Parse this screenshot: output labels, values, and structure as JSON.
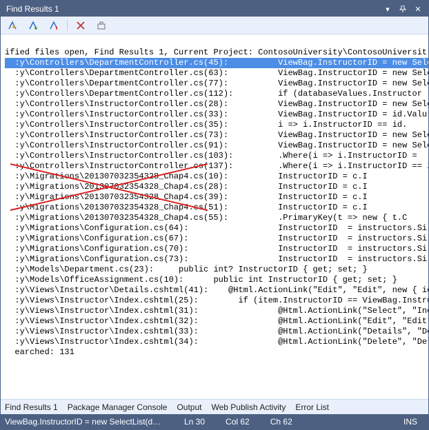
{
  "window": {
    "title": "Find Results 1"
  },
  "header_line": "ified files open, Find Results 1, Current Project: ContosoUniversity\\ContosoUniversit",
  "lines": [
    {
      "path": ":y\\Controllers\\DepartmentController.cs(45):",
      "code": "ViewBag.InstructorID = new Select",
      "selected": true,
      "struck": false
    },
    {
      "path": ":y\\Controllers\\DepartmentController.cs(63):",
      "code": "ViewBag.InstructorID = new Select",
      "selected": false,
      "struck": false
    },
    {
      "path": ":y\\Controllers\\DepartmentController.cs(77):",
      "code": "ViewBag.InstructorID = new Select",
      "selected": false,
      "struck": false
    },
    {
      "path": ":y\\Controllers\\DepartmentController.cs(112):",
      "code": "if (databaseValues.Instructor",
      "selected": false,
      "struck": false
    },
    {
      "path": ":y\\Controllers\\InstructorController.cs(28):",
      "code": "ViewBag.InstructorID = new Selec",
      "selected": false,
      "struck": false
    },
    {
      "path": ":y\\Controllers\\InstructorController.cs(33):",
      "code": "ViewBag.InstructorID = id.Valu",
      "selected": false,
      "struck": false
    },
    {
      "path": ":y\\Controllers\\InstructorController.cs(35):",
      "code": "i => i.InstructorID == id.",
      "selected": false,
      "struck": false
    },
    {
      "path": ":y\\Controllers\\InstructorController.cs(73):",
      "code": "ViewBag.InstructorID = new Select",
      "selected": false,
      "struck": false
    },
    {
      "path": ":y\\Controllers\\InstructorController.cs(91):",
      "code": "ViewBag.InstructorID = new Select",
      "selected": false,
      "struck": false
    },
    {
      "path": ":y\\Controllers\\InstructorController.cs(103):",
      "code": ".Where(i => i.InstructorID =",
      "selected": false,
      "struck": false
    },
    {
      "path": ":y\\Controllers\\InstructorController.cs(137):",
      "code": ".Where(i => i.InstructorID == id)",
      "selected": false,
      "struck": false
    },
    {
      "path": ":y\\Migrations\\201307032354328_Chap4.cs(10):",
      "code": "InstructorID = c.I",
      "selected": false,
      "struck": true
    },
    {
      "path": ":y\\Migrations\\201307032354328_Chap4.cs(28):",
      "code": "InstructorID = c.I",
      "selected": false,
      "struck": true
    },
    {
      "path": ":y\\Migrations\\201307032354328_Chap4.cs(39):",
      "code": "InstructorID = c.I",
      "selected": false,
      "struck": true
    },
    {
      "path": ":y\\Migrations\\201307032354328_Chap4.cs(51):",
      "code": "InstructorID = c.I",
      "selected": false,
      "struck": true
    },
    {
      "path": ":y\\Migrations\\201307032354328_Chap4.cs(55):",
      "code": ".PrimaryKey(t => new { t.C",
      "selected": false,
      "struck": true
    },
    {
      "path": ":y\\Migrations\\Configuration.cs(64):",
      "code": "InstructorID  = instructors.Si",
      "selected": false,
      "struck": false
    },
    {
      "path": ":y\\Migrations\\Configuration.cs(67):",
      "code": "InstructorID  = instructors.Si",
      "selected": false,
      "struck": false
    },
    {
      "path": ":y\\Migrations\\Configuration.cs(70):",
      "code": "InstructorID  = instructors.Si",
      "selected": false,
      "struck": false
    },
    {
      "path": ":y\\Migrations\\Configuration.cs(73):",
      "code": "InstructorID  = instructors.Si",
      "selected": false,
      "struck": false
    },
    {
      "path": ":y\\Models\\Department.cs(23):",
      "code": "public int? InstructorID { get; set; }",
      "selected": false,
      "struck": false,
      "col2": 35
    },
    {
      "path": ":y\\Models\\OfficeAssignment.cs(10):",
      "code": "public int InstructorID { get; set; }",
      "selected": false,
      "struck": false,
      "col2": 42
    },
    {
      "path": ":y\\Views\\Instructor\\Details.cshtml(41):",
      "code": "@Html.ActionLink(\"Edit\", \"Edit\", new { id=",
      "selected": false,
      "struck": false,
      "col2": 45
    },
    {
      "path": ":y\\Views\\Instructor\\Index.cshtml(25):",
      "code": "if (item.InstructorID == ViewBag.Instruc",
      "selected": false,
      "struck": false,
      "col2": 47
    },
    {
      "path": ":y\\Views\\Instructor\\Index.cshtml(31):",
      "code": "@Html.ActionLink(\"Select\", \"Inde",
      "selected": false,
      "struck": false
    },
    {
      "path": ":y\\Views\\Instructor\\Index.cshtml(32):",
      "code": "@Html.ActionLink(\"Edit\", \"Edit\",",
      "selected": false,
      "struck": false
    },
    {
      "path": ":y\\Views\\Instructor\\Index.cshtml(33):",
      "code": "@Html.ActionLink(\"Details\", \"Det",
      "selected": false,
      "struck": false
    },
    {
      "path": ":y\\Views\\Instructor\\Index.cshtml(34):",
      "code": "@Html.ActionLink(\"Delete\", \"Dele",
      "selected": false,
      "struck": false
    }
  ],
  "footer_line": "earched: 131",
  "tabs": {
    "0": "Find Results 1",
    "1": "Package Manager Console",
    "2": "Output",
    "3": "Web Publish Activity",
    "4": "Error List"
  },
  "status": {
    "msg": "ViewBag.InstructorID = new SelectList(db....",
    "ln": "Ln 30",
    "col": "Col 62",
    "ch": "Ch 62",
    "ins": "INS"
  }
}
